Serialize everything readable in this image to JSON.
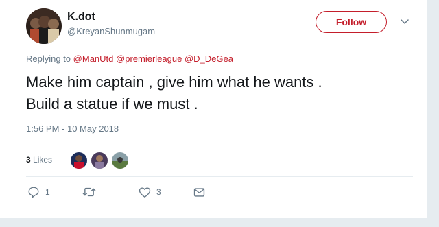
{
  "user": {
    "name": "K.dot",
    "handle": "@KreyanShunmugam"
  },
  "follow_label": "Follow",
  "reply": {
    "prefix": "Replying to",
    "mentions": [
      "@ManUtd",
      "@premierleague",
      "@D_DeGea"
    ]
  },
  "tweet": {
    "line1": "Make him captain , give him what he wants .",
    "line2": "Build a statue if we must ."
  },
  "timestamp": "1:56 PM - 10 May 2018",
  "likes": {
    "count": "3",
    "label": "Likes"
  },
  "actions": {
    "reply_count": "1",
    "like_count": "3"
  },
  "colors": {
    "accent": "#c41e2b",
    "muted": "#657786",
    "text": "#14171a"
  }
}
